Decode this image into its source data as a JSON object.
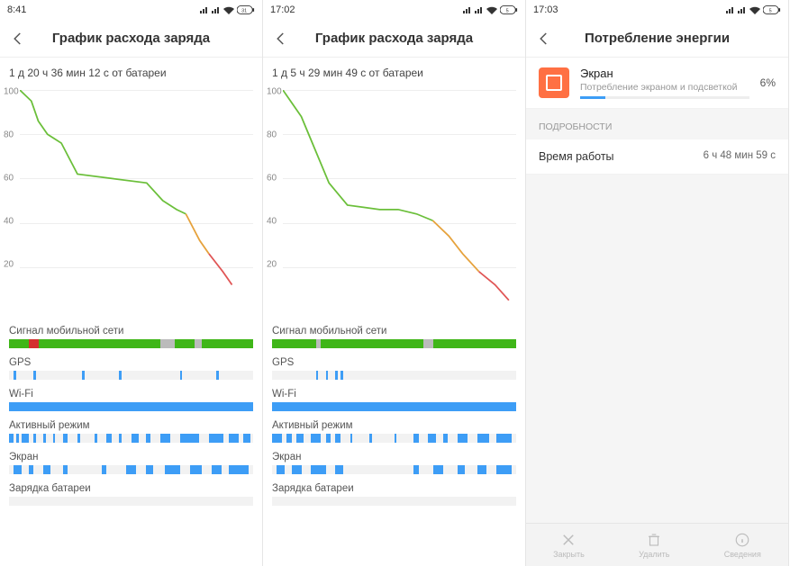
{
  "screens": [
    {
      "status_time": "8:41",
      "title": "График расхода заряда",
      "duration": "1 д 20 ч 36 мин 12 с от батареи",
      "sections": {
        "mobile": "Сигнал мобильной сети",
        "gps": "GPS",
        "wifi": "Wi-Fi",
        "active": "Активный режим",
        "screen": "Экран",
        "charging": "Зарядка батареи"
      }
    },
    {
      "status_time": "17:02",
      "title": "График расхода заряда",
      "duration": "1 д 5 ч 29 мин 49 с от батареи",
      "sections": {
        "mobile": "Сигнал мобильной сети",
        "gps": "GPS",
        "wifi": "Wi-Fi",
        "active": "Активный режим",
        "screen": "Экран",
        "charging": "Зарядка батареи"
      }
    },
    {
      "status_time": "17:03",
      "title": "Потребление энергии",
      "app": {
        "name": "Экран",
        "sub": "Потребление экраном и подсветкой",
        "pct": "6%"
      },
      "details_header": "ПОДРОБНОСТИ",
      "runtime_label": "Время работы",
      "runtime_value": "6 ч 48 мин 59 с",
      "bottom": {
        "close": "Закрыть",
        "delete": "Удалить",
        "info": "Сведения"
      }
    }
  ],
  "chart_data": [
    {
      "type": "line",
      "ylabel": "",
      "xlabel": "",
      "ylim": [
        0,
        100
      ],
      "y_ticks": [
        100,
        80,
        60,
        40,
        20
      ],
      "series": [
        {
          "name": "battery",
          "color_segments": [
            "green",
            "green",
            "green",
            "green",
            "orange",
            "red"
          ],
          "points": [
            [
              0,
              100
            ],
            [
              5,
              95
            ],
            [
              8,
              86
            ],
            [
              12,
              80
            ],
            [
              15,
              78
            ],
            [
              18,
              76
            ],
            [
              25,
              62
            ],
            [
              40,
              60
            ],
            [
              55,
              58
            ],
            [
              62,
              50
            ],
            [
              68,
              46
            ],
            [
              72,
              44
            ],
            [
              78,
              32
            ],
            [
              82,
              26
            ],
            [
              88,
              18
            ],
            [
              92,
              12
            ]
          ]
        }
      ]
    },
    {
      "type": "line",
      "ylabel": "",
      "xlabel": "",
      "ylim": [
        0,
        100
      ],
      "y_ticks": [
        100,
        80,
        60,
        40,
        20
      ],
      "series": [
        {
          "name": "battery",
          "color_segments": [
            "green",
            "green",
            "green",
            "green",
            "orange",
            "red"
          ],
          "points": [
            [
              0,
              100
            ],
            [
              4,
              94
            ],
            [
              8,
              88
            ],
            [
              12,
              78
            ],
            [
              16,
              68
            ],
            [
              20,
              58
            ],
            [
              28,
              48
            ],
            [
              35,
              47
            ],
            [
              42,
              46
            ],
            [
              50,
              46
            ],
            [
              58,
              44
            ],
            [
              65,
              41
            ],
            [
              72,
              34
            ],
            [
              78,
              26
            ],
            [
              85,
              18
            ],
            [
              92,
              12
            ],
            [
              98,
              5
            ]
          ]
        }
      ]
    }
  ]
}
